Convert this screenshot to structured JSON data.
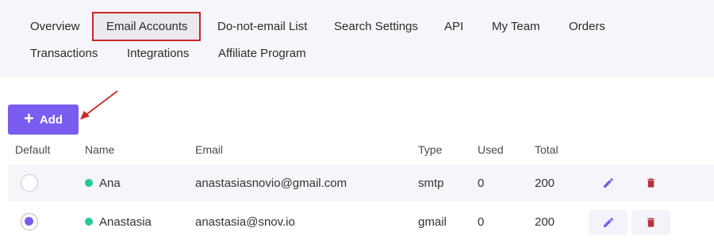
{
  "tabs": [
    {
      "label": "Overview",
      "active": false
    },
    {
      "label": "Email Accounts",
      "active": true
    },
    {
      "label": "Do-not-email List",
      "active": false
    },
    {
      "label": "Search Settings",
      "active": false
    },
    {
      "label": "API",
      "active": false
    },
    {
      "label": "My Team",
      "active": false
    },
    {
      "label": "Orders",
      "active": false
    },
    {
      "label": "Transactions",
      "active": false
    },
    {
      "label": "Integrations",
      "active": false
    },
    {
      "label": "Affiliate Program",
      "active": false
    }
  ],
  "add_button": {
    "label": "Add",
    "icon": "plus-icon"
  },
  "table": {
    "headers": [
      "Default",
      "Name",
      "Email",
      "Type",
      "Used",
      "Total"
    ],
    "rows": [
      {
        "default": false,
        "name": "Ana",
        "status_color": "#26c79a",
        "email": "anastasiasnovio@gmail.com",
        "type": "smtp",
        "used": "0",
        "total": "200"
      },
      {
        "default": true,
        "name": "Anastasia",
        "status_color": "#26c79a",
        "email": "anastasia@snov.io",
        "type": "gmail",
        "used": "0",
        "total": "200"
      }
    ]
  },
  "colors": {
    "accent": "#7a5cf0",
    "highlight_border": "#c62828",
    "delete": "#b3323a",
    "status_active": "#26c79a"
  }
}
